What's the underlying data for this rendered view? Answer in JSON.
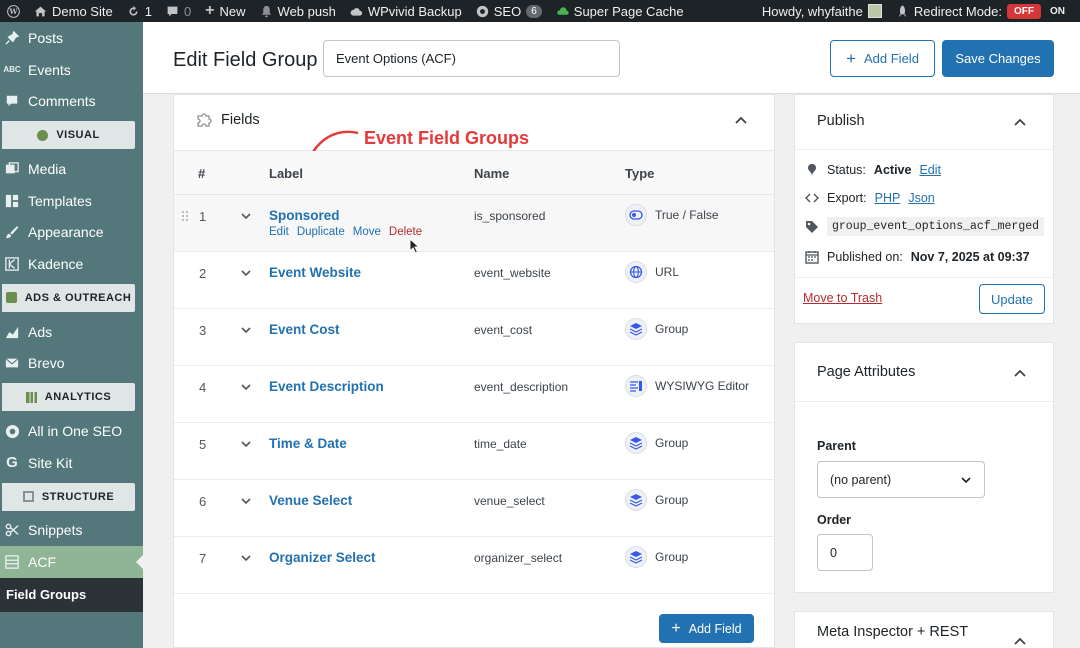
{
  "admin_bar": {
    "site_name": "Demo Site",
    "updates_count": "1",
    "comments_count": "0",
    "new_label": "New",
    "web_push_label": "Web push",
    "wpvivid_label": "WPvivid Backup",
    "seo_label": "SEO",
    "seo_badge": "6",
    "cache_label": "Super Page Cache",
    "howdy_label": "Howdy, whyfaithe",
    "redirect_label": "Redirect Mode:",
    "redirect_off": "OFF",
    "redirect_on": "ON"
  },
  "sidebar": {
    "items_top": [
      {
        "label": "Posts",
        "icon": "pin-icon"
      },
      {
        "label": "Events",
        "icon": "abc-icon"
      },
      {
        "label": "Comments",
        "icon": "comment-icon"
      }
    ],
    "section_visual": "VISUAL",
    "items_visual": [
      {
        "label": "Media",
        "icon": "media-icon"
      },
      {
        "label": "Templates",
        "icon": "templates-icon"
      },
      {
        "label": "Appearance",
        "icon": "brush-icon"
      },
      {
        "label": "Kadence",
        "icon": "kadence-icon"
      }
    ],
    "section_ads": "ADS & OUTREACH",
    "items_ads": [
      {
        "label": "Ads",
        "icon": "chart-icon"
      },
      {
        "label": "Brevo",
        "icon": "mail-icon"
      }
    ],
    "section_analytics": "ANALYTICS",
    "items_analytics": [
      {
        "label": "All in One SEO",
        "icon": "aioseo-icon"
      },
      {
        "label": "Site Kit",
        "icon": "google-icon"
      }
    ],
    "section_structure": "STRUCTURE",
    "items_structure": [
      {
        "label": "Snippets",
        "icon": "scissors-icon"
      },
      {
        "label": "ACF",
        "icon": "acf-icon"
      }
    ],
    "submenu_active": "Field Groups"
  },
  "header": {
    "title": "Edit Field Group",
    "group_name": "Event Options (ACF)",
    "add_field_label": "Add Field",
    "save_label": "Save Changes"
  },
  "fields_panel": {
    "title": "Fields",
    "annotation": "Event Field Groups",
    "columns": {
      "num": "#",
      "label": "Label",
      "name": "Name",
      "type": "Type"
    },
    "rows": [
      {
        "num": "1",
        "label": "Sponsored",
        "name": "is_sponsored",
        "type": "True / False",
        "icon": "toggle-icon"
      },
      {
        "num": "2",
        "label": "Event Website",
        "name": "event_website",
        "type": "URL",
        "icon": "globe-icon"
      },
      {
        "num": "3",
        "label": "Event Cost",
        "name": "event_cost",
        "type": "Group",
        "icon": "layers-icon"
      },
      {
        "num": "4",
        "label": "Event Description",
        "name": "event_description",
        "type": "WYSIWYG Editor",
        "icon": "editor-icon"
      },
      {
        "num": "5",
        "label": "Time & Date",
        "name": "time_date",
        "type": "Group",
        "icon": "layers-icon"
      },
      {
        "num": "6",
        "label": "Venue Select",
        "name": "venue_select",
        "type": "Group",
        "icon": "layers-icon"
      },
      {
        "num": "7",
        "label": "Organizer Select",
        "name": "organizer_select",
        "type": "Group",
        "icon": "layers-icon"
      }
    ],
    "row_actions": {
      "edit": "Edit",
      "duplicate": "Duplicate",
      "move": "Move",
      "delete": "Delete"
    },
    "add_field_label": "Add Field"
  },
  "publish": {
    "title": "Publish",
    "status_label": "Status:",
    "status_value": "Active",
    "status_edit": "Edit",
    "export_label": "Export:",
    "export_php": "PHP",
    "export_json": "Json",
    "key": "group_event_options_acf_merged",
    "published_label": "Published on:",
    "published_value": "Nov 7, 2025 at 09:37",
    "trash_label": "Move to Trash",
    "update_label": "Update"
  },
  "page_attributes": {
    "title": "Page Attributes",
    "parent_label": "Parent",
    "parent_value": "(no parent)",
    "order_label": "Order",
    "order_value": "0"
  },
  "meta_inspector": {
    "title": "Meta Inspector + REST"
  },
  "colors": {
    "accent": "#2271b1",
    "sidebar_bg": "#53777a",
    "annotation": "#e5393a",
    "danger": "#b32d2e"
  }
}
